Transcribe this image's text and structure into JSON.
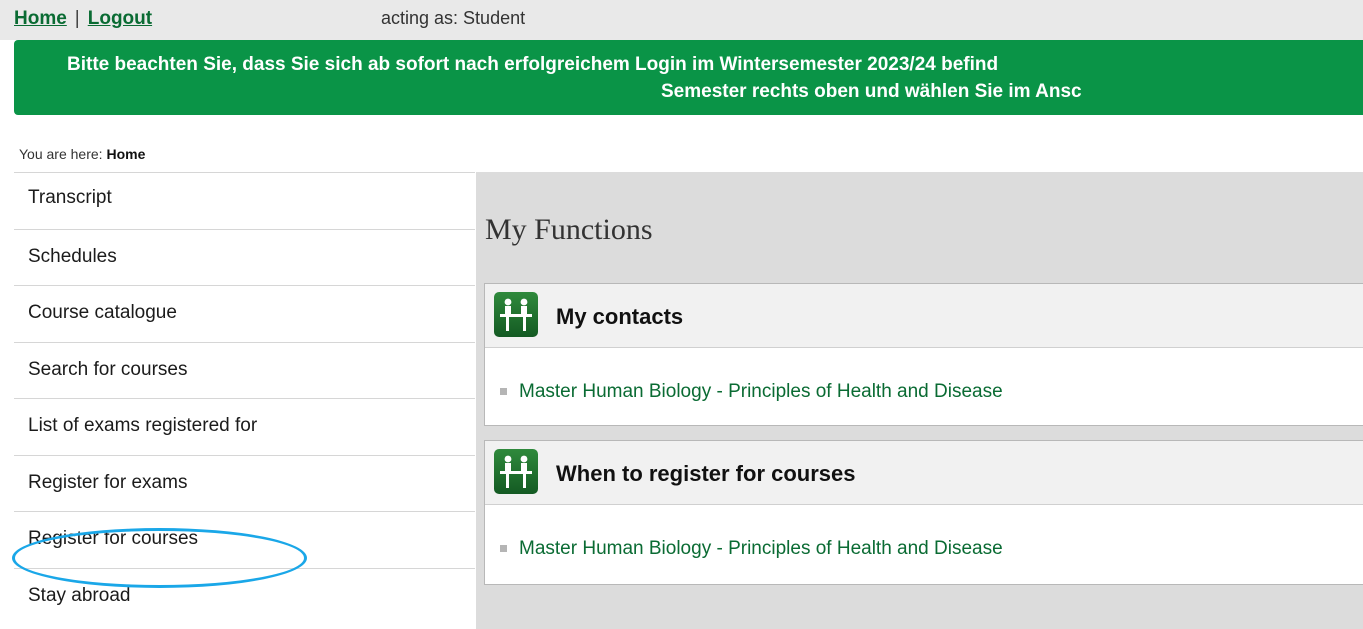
{
  "topbar": {
    "home": "Home",
    "separator": "|",
    "logout": "Logout",
    "acting_as": "acting as: Student"
  },
  "banner": {
    "line1": "Bitte beachten Sie, dass Sie sich ab sofort nach erfolgreichem Login im Wintersemester 2023/24 befind",
    "line2": "Semester rechts oben und wählen Sie im Ansc"
  },
  "breadcrumb": {
    "prefix": "You are here:",
    "current": "Home"
  },
  "sidebar": {
    "items": [
      {
        "label": "Transcript"
      },
      {
        "label": "Schedules"
      },
      {
        "label": "Course catalogue"
      },
      {
        "label": "Search for courses"
      },
      {
        "label": "List of exams registered for"
      },
      {
        "label": "Register for exams"
      },
      {
        "label": "Register for courses"
      },
      {
        "label": "Stay abroad"
      }
    ]
  },
  "main": {
    "title": "My Functions",
    "cards": [
      {
        "title": "My contacts",
        "link": "Master Human Biology - Principles of Health and Disease",
        "icon": "people-icon"
      },
      {
        "title": "When to register for courses",
        "link": "Master Human Biology - Principles of Health and Disease",
        "icon": "people-icon"
      }
    ]
  },
  "colors": {
    "brand_green": "#0a9447",
    "link_green": "#0a6b33",
    "highlight_circle": "#1aa7e8"
  }
}
